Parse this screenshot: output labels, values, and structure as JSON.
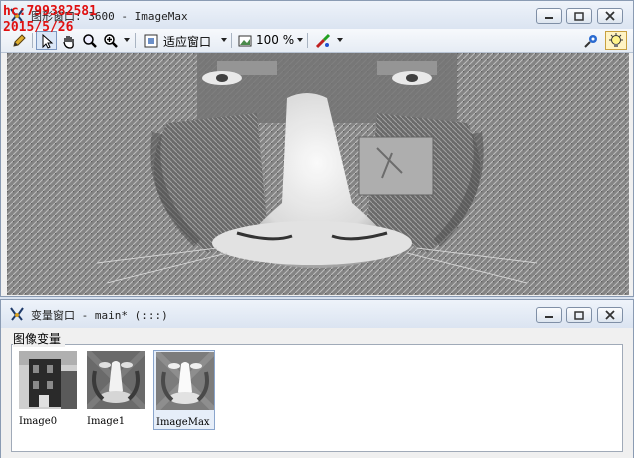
{
  "graphics_window": {
    "title": "图形窗口: 3600 - ImageMax",
    "icon": "halcon-graphics-icon",
    "toolbar": {
      "zoom_mode_label": "适应窗口",
      "zoom_percent": "100",
      "zoom_unit": "%"
    },
    "overlay": {
      "line1": "hc:799382581",
      "line2": "2015/5/26",
      "color": "#e01010"
    }
  },
  "variable_window": {
    "title": "变量窗口 - main* (:::)",
    "group_label": "图像变量",
    "variables": [
      {
        "name": "Image0"
      },
      {
        "name": "Image1"
      },
      {
        "name": "ImageMax"
      }
    ],
    "selected_index": 2
  }
}
